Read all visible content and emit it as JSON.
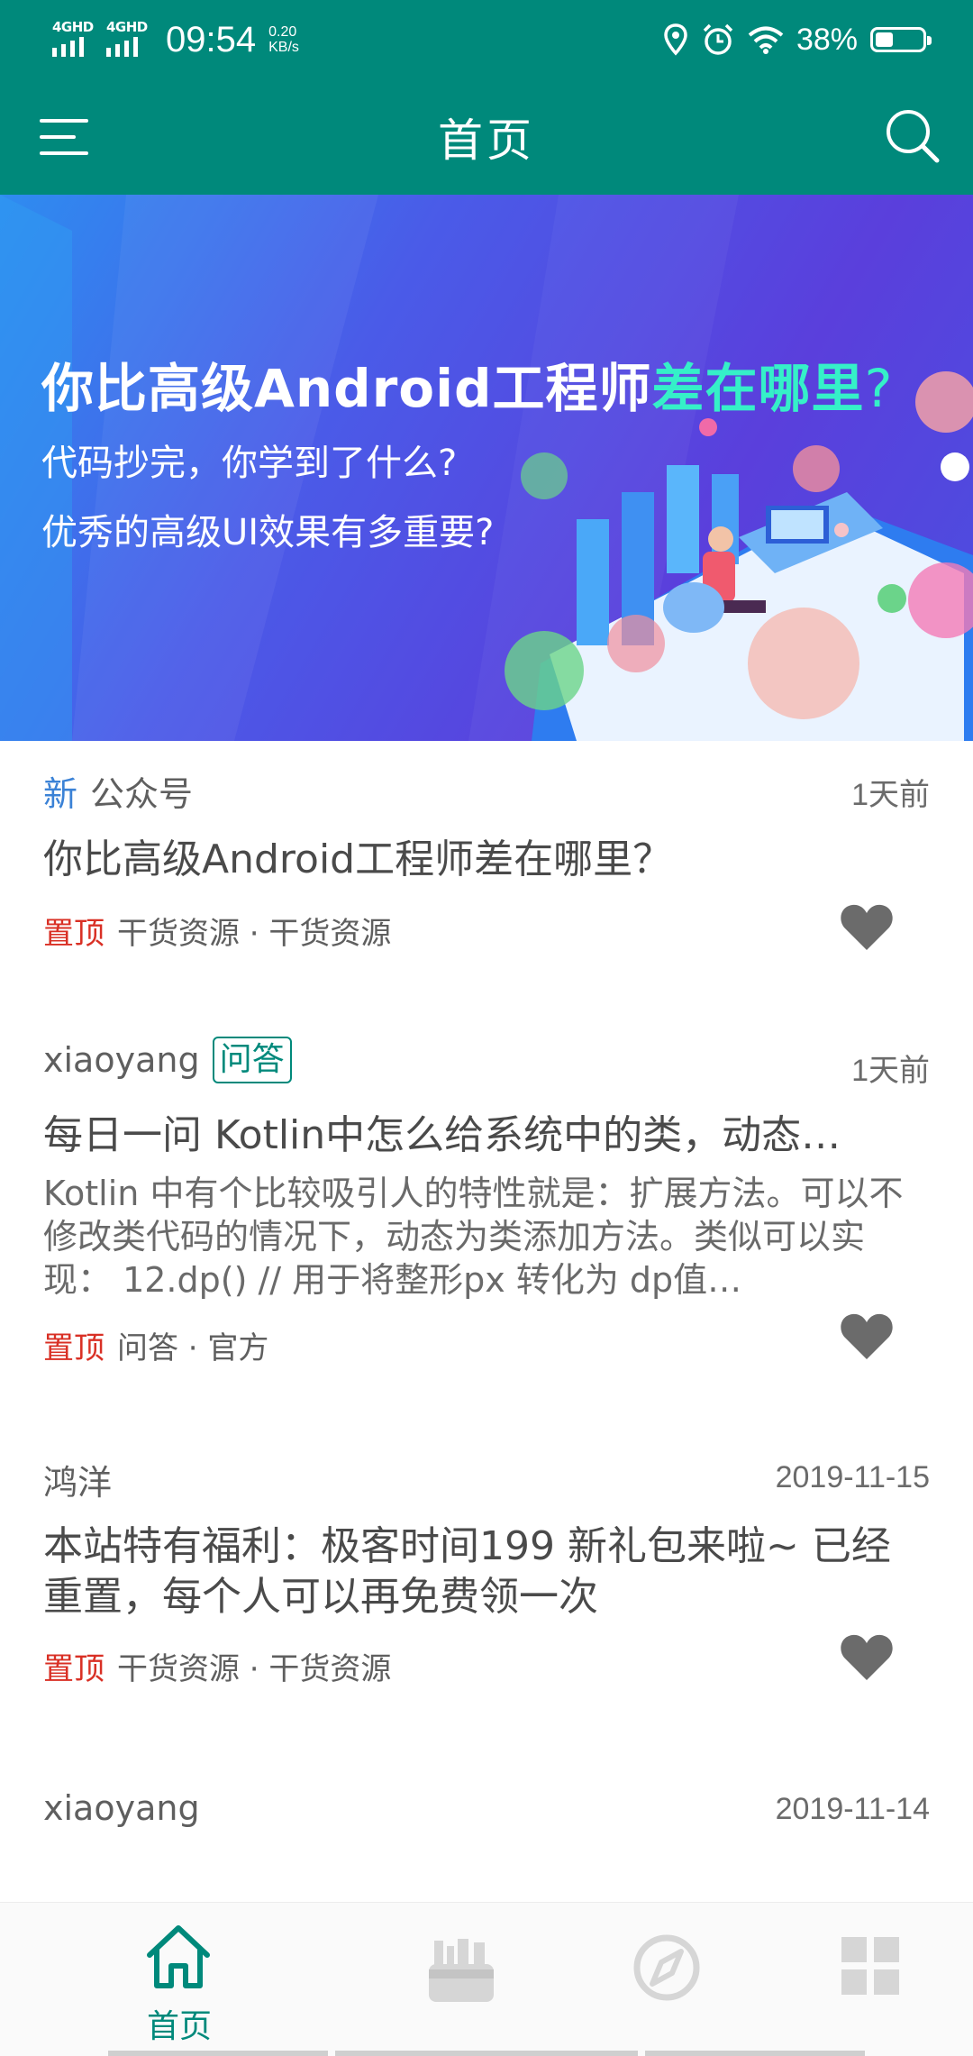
{
  "status_bar": {
    "network1": "4GHD",
    "network2": "4GHD",
    "time": "09:54",
    "speed_value": "0.20",
    "speed_unit": "KB/s",
    "battery_text": "38%",
    "battery_level": 0.38,
    "icons": [
      "location-icon",
      "alarm-icon",
      "wifi-icon",
      "battery-icon"
    ]
  },
  "app_bar": {
    "title": "首页",
    "left_icon": "menu-icon",
    "right_icon": "search-icon"
  },
  "banner": {
    "headline_part1": "你比高级Android工程师",
    "headline_highlight": "差在哪里",
    "headline_q": "?",
    "line2": "代码抄完，你学到了什么?",
    "line3": "优秀的高级UI效果有多重要?",
    "accent": "#35f0c8"
  },
  "feed": [
    {
      "new_badge": "新",
      "author": "公众号",
      "time": "1天前",
      "title": "你比高级Android工程师差在哪里？",
      "top_tag": "置顶",
      "category": "干货资源 · 干货资源"
    },
    {
      "author": "xiaoyang",
      "qa_badge": "问答",
      "time": "1天前",
      "title": "每日一问 Kotlin中怎么给系统中的类，动态…",
      "description": "Kotlin 中有个比较吸引人的特性就是：扩展方法。可以不修改类代码的情况下，动态为类添加方法。类似可以实现： 12.dp() // 用于将整形px 转化为 dp值…",
      "top_tag": "置顶",
      "category": "问答 · 官方"
    },
    {
      "author": "鸿洋",
      "time": "2019-11-15",
      "title": "本站特有福利：极客时间199 新礼包来啦~ 已经重置，每个人可以再免费领一次",
      "top_tag": "置顶",
      "category": "干货资源 · 干货资源"
    },
    {
      "author": "xiaoyang",
      "time": "2019-11-14"
    }
  ],
  "bottom_nav": {
    "items": [
      {
        "icon": "home-icon",
        "label": "首页",
        "active": true
      },
      {
        "icon": "project-icon",
        "label": "",
        "active": false
      },
      {
        "icon": "compass-icon",
        "label": "",
        "active": false
      },
      {
        "icon": "grid-icon",
        "label": "",
        "active": false
      }
    ],
    "active_color": "#00897b",
    "inactive_color": "#cfcfcf"
  },
  "colors": {
    "primary": "#00897b",
    "top_tag": "#d93025",
    "new_badge": "#3b82d6"
  }
}
